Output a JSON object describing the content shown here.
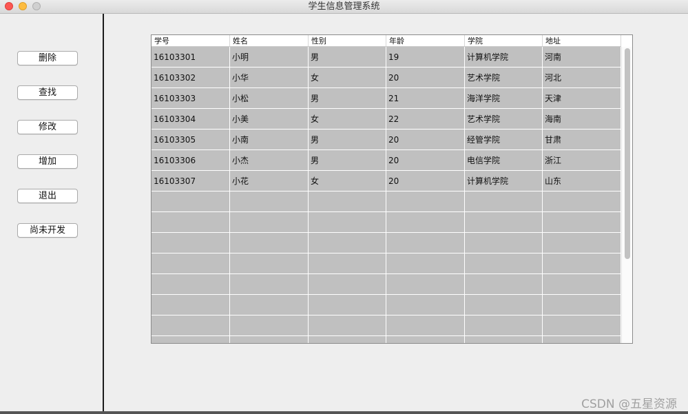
{
  "window": {
    "title": "学生信息管理系统"
  },
  "sidebar": {
    "buttons": [
      {
        "label": "删除"
      },
      {
        "label": "查找"
      },
      {
        "label": "修改"
      },
      {
        "label": "增加"
      },
      {
        "label": "退出"
      },
      {
        "label": "尚未开发"
      }
    ]
  },
  "table": {
    "headers": [
      "学号",
      "姓名",
      "性别",
      "年龄",
      "学院",
      "地址"
    ],
    "rows": [
      [
        "16103301",
        "小明",
        "男",
        "19",
        "计算机学院",
        "河南"
      ],
      [
        "16103302",
        "小华",
        "女",
        "20",
        "艺术学院",
        "河北"
      ],
      [
        "16103303",
        "小松",
        "男",
        "21",
        "海洋学院",
        "天津"
      ],
      [
        "16103304",
        "小美",
        "女",
        "22",
        "艺术学院",
        "海南"
      ],
      [
        "16103305",
        "小南",
        "男",
        "20",
        "经管学院",
        "甘肃"
      ],
      [
        "16103306",
        "小杰",
        "男",
        "20",
        "电信学院",
        "浙江"
      ],
      [
        "16103307",
        "小花",
        "女",
        "20",
        "计算机学院",
        "山东"
      ]
    ],
    "empty_row_count": 8
  },
  "watermark": {
    "text": "CSDN @五星资源"
  },
  "colors": {
    "close": "#fc5753",
    "minimize": "#fdbc40",
    "maximize_disabled": "#d0d0d0",
    "row_fill": "#c0c0c0"
  }
}
